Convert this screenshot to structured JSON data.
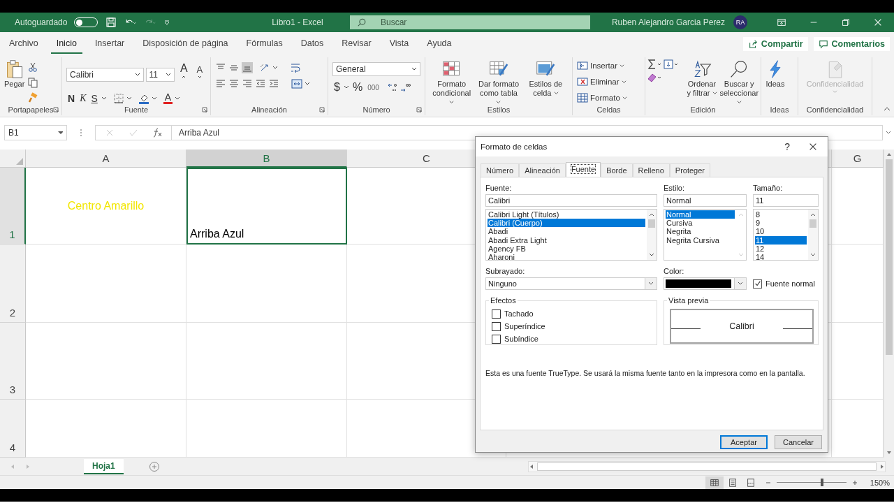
{
  "title_bar": {
    "autosave_label": "Autoguardado",
    "autosave_on": false,
    "title": "Libro1  -  Excel",
    "search_placeholder": "Buscar",
    "user_name": "Ruben Alejandro Garcia Perez",
    "avatar": "RA"
  },
  "menu_tabs": [
    {
      "label": "Archivo",
      "selected": false
    },
    {
      "label": "Inicio",
      "selected": true
    },
    {
      "label": "Insertar",
      "selected": false
    },
    {
      "label": "Disposición de página",
      "selected": false
    },
    {
      "label": "Fórmulas",
      "selected": false
    },
    {
      "label": "Datos",
      "selected": false
    },
    {
      "label": "Revisar",
      "selected": false
    },
    {
      "label": "Vista",
      "selected": false
    },
    {
      "label": "Ayuda",
      "selected": false
    }
  ],
  "share_button": "Compartir",
  "comments_button": "Comentarios",
  "ribbon": {
    "clipboard": {
      "paste": "Pegar",
      "group": "Portapapeles"
    },
    "font": {
      "name": "Calibri",
      "size": "11",
      "grow": "A",
      "shrink": "A",
      "bold": "N",
      "italic": "K",
      "underline": "S",
      "font_color": "A",
      "group": "Fuente"
    },
    "alignment": {
      "group": "Alineación"
    },
    "number": {
      "format": "General",
      "currency": "$",
      "percent": "%",
      "thousands": "000",
      "group": "Número"
    },
    "styles": {
      "buttons": [
        "Formato condicional",
        "Dar formato como tabla",
        "Estilos de celda"
      ],
      "group": "Estilos"
    },
    "cells": {
      "buttons": [
        "Insertar",
        "Eliminar",
        "Formato"
      ],
      "group": "Celdas"
    },
    "editing": {
      "buttons": [
        "Ordenar y filtrar",
        "Buscar y seleccionar"
      ],
      "group": "Edición"
    },
    "ideas": {
      "button": "Ideas",
      "group": "Ideas"
    },
    "sensitivity": {
      "button": "Confidencialidad",
      "disabled": true,
      "group": "Confidencialidad"
    }
  },
  "formula_bar": {
    "name_box": "B1",
    "value": "Arriba Azul"
  },
  "sheet": {
    "columns": [
      {
        "label": "A",
        "selected": false
      },
      {
        "label": "B",
        "selected": true
      },
      {
        "label": "C",
        "selected": false
      },
      {
        "label": "G",
        "selected": false
      }
    ],
    "rows": [
      {
        "label": "1",
        "selected": true,
        "cells": [
          {
            "text": "Centro Amarillo",
            "kind": "centered",
            "color": "#f2e600",
            "selected": false
          },
          {
            "text": "Arriba Azul",
            "kind": "bottom",
            "color": "#000000",
            "selected": true
          }
        ]
      },
      {
        "label": "2",
        "selected": false
      },
      {
        "label": "3",
        "selected": false
      },
      {
        "label": "4",
        "selected": false
      }
    ]
  },
  "sheet_tabs": [
    {
      "label": "Hoja1",
      "selected": true
    }
  ],
  "status_bar": {
    "level": 0.66,
    "zoom": "150%"
  },
  "dialog": {
    "title": "Formato de celdas",
    "help": "?",
    "tabs": [
      {
        "label": "Número",
        "selected": false
      },
      {
        "label": "Alineación",
        "selected": false
      },
      {
        "label": "Fuente",
        "selected": true
      },
      {
        "label": "Borde",
        "selected": false
      },
      {
        "label": "Relleno",
        "selected": false
      },
      {
        "label": "Proteger",
        "selected": false
      }
    ],
    "font_label": "Fuente:",
    "font_value": "Calibri",
    "fonts": [
      {
        "label": "Calibri Light (Títulos)",
        "selected": false
      },
      {
        "label": "Calibri (Cuerpo)",
        "selected": true
      },
      {
        "label": "Abadi",
        "selected": false
      },
      {
        "label": "Abadi Extra Light",
        "selected": false
      },
      {
        "label": "Agency FB",
        "selected": false
      },
      {
        "label": "Aharoni",
        "selected": false
      }
    ],
    "style_label": "Estilo:",
    "style_value": "Normal",
    "styles": [
      {
        "label": "Normal",
        "selected": true
      },
      {
        "label": "Cursiva",
        "selected": false
      },
      {
        "label": "Negrita",
        "selected": false
      },
      {
        "label": "Negrita Cursiva",
        "selected": false
      }
    ],
    "size_label": "Tamaño:",
    "size_value": "11",
    "sizes": [
      {
        "label": "8",
        "selected": false
      },
      {
        "label": "9",
        "selected": false
      },
      {
        "label": "10",
        "selected": false
      },
      {
        "label": "11",
        "selected": true
      },
      {
        "label": "12",
        "selected": false
      },
      {
        "label": "14",
        "selected": false
      }
    ],
    "underline_label": "Subrayado:",
    "underline_value": "Ninguno",
    "color_label": "Color:",
    "normal_font": {
      "label": "Fuente normal",
      "checked": true
    },
    "effects_label": "Efectos",
    "effects": [
      {
        "label": "Tachado",
        "checked": false
      },
      {
        "label": "Superíndice",
        "checked": false
      },
      {
        "label": "Subíndice",
        "checked": false
      }
    ],
    "preview_label": "Vista previa",
    "preview_text": "Calibri",
    "note": "Esta es una fuente TrueType. Se usará la misma fuente tanto en la impresora como en la pantalla.",
    "ok": "Aceptar",
    "cancel": "Cancelar"
  }
}
